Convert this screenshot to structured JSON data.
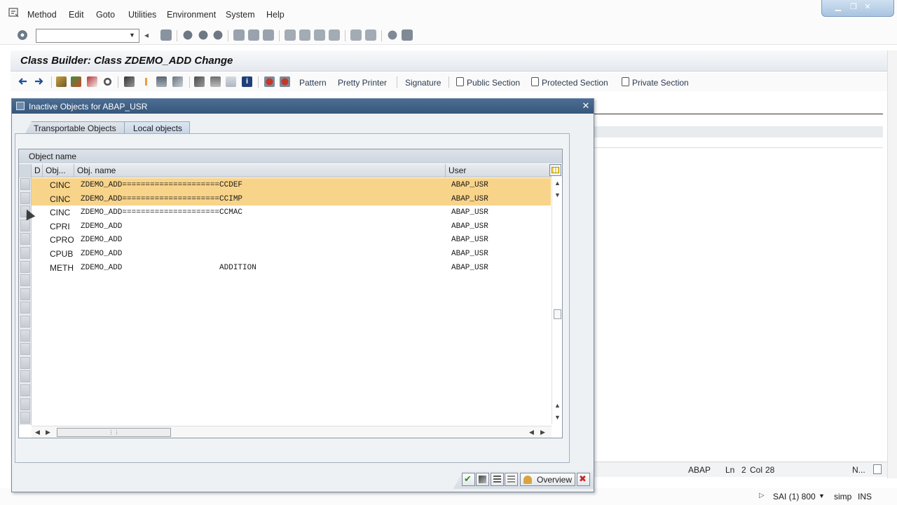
{
  "menubar": {
    "items": [
      "Method",
      "Edit",
      "Goto",
      "Utilities",
      "Environment",
      "System",
      "Help"
    ]
  },
  "command_field": {
    "value": ""
  },
  "title": "Class Builder: Class ZDEMO_ADD Change",
  "app_toolbar": {
    "pattern": "Pattern",
    "pretty_printer": "Pretty Printer",
    "signature": "Signature",
    "public_section": "Public Section",
    "protected_section": "Protected Section",
    "private_section": "Private Section"
  },
  "dialog": {
    "title": "Inactive Objects for ABAP_USR",
    "tabs": [
      "Transportable Objects",
      "Local objects"
    ],
    "active_tab": "Local objects",
    "grid": {
      "caption": "Object name",
      "columns": [
        "D",
        "Obj...",
        "Obj. name",
        "User"
      ],
      "rows": [
        {
          "type": "CINC",
          "name": "ZDEMO_ADD=====================CCDEF",
          "user": "ABAP_USR",
          "selected": true
        },
        {
          "type": "CINC",
          "name": "ZDEMO_ADD=====================CCIMP",
          "user": "ABAP_USR",
          "selected": true
        },
        {
          "type": "CINC",
          "name": "ZDEMO_ADD=====================CCMAC",
          "user": "ABAP_USR",
          "selected": false
        },
        {
          "type": "CPRI",
          "name": "ZDEMO_ADD",
          "user": "ABAP_USR",
          "selected": false
        },
        {
          "type": "CPRO",
          "name": "ZDEMO_ADD",
          "user": "ABAP_USR",
          "selected": false
        },
        {
          "type": "CPUB",
          "name": "ZDEMO_ADD",
          "user": "ABAP_USR",
          "selected": false
        },
        {
          "type": "METH",
          "name": "ZDEMO_ADD                     ADDITION",
          "user": "ABAP_USR",
          "selected": false
        }
      ]
    },
    "footer": {
      "overview": "Overview"
    }
  },
  "editor_status": {
    "lang": "ABAP",
    "ln_label": "Ln",
    "ln": "2",
    "col_label": "Col",
    "col": "28",
    "extra": "N..."
  },
  "statusbar": {
    "system": "SAI (1) 800",
    "user": "simp",
    "mode": "INS"
  },
  "colors": {
    "selection": "#f8d48a",
    "dialog_header": "#36577c",
    "accept": "#2e8b22",
    "cancel": "#c62828"
  }
}
